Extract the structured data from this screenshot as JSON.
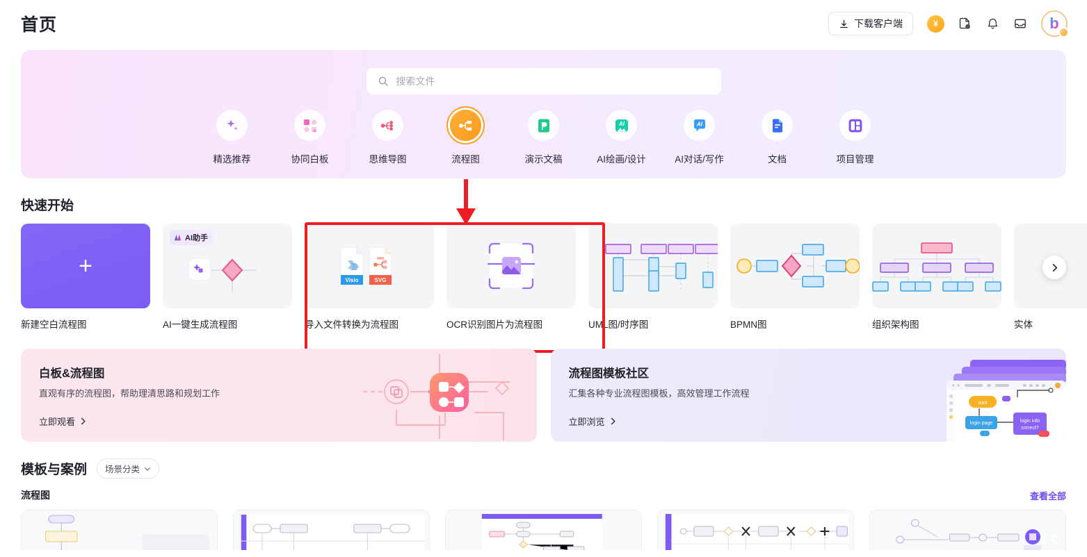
{
  "header": {
    "title": "首页",
    "download_label": "下载客户端",
    "coin_glyph": "¥",
    "avatar_letter": "b",
    "icons": [
      "download-icon",
      "coin-icon",
      "doc-link-icon",
      "bell-icon",
      "inbox-icon",
      "avatar"
    ]
  },
  "hero": {
    "search": {
      "placeholder": "搜索文件",
      "value": ""
    },
    "categories": [
      {
        "label": "精选推荐",
        "icon": "sparkle-icon",
        "active": false
      },
      {
        "label": "协同白板",
        "icon": "whiteboard-icon",
        "active": false
      },
      {
        "label": "思维导图",
        "icon": "mindmap-icon",
        "active": false
      },
      {
        "label": "流程图",
        "icon": "flowchart-icon",
        "active": true
      },
      {
        "label": "演示文稿",
        "icon": "presentation-icon",
        "active": false
      },
      {
        "label": "AI绘画/设计",
        "icon": "ai-image-icon",
        "active": false
      },
      {
        "label": "AI对话/写作",
        "icon": "ai-chat-icon",
        "active": false
      },
      {
        "label": "文档",
        "icon": "document-icon",
        "active": false
      },
      {
        "label": "项目管理",
        "icon": "project-icon",
        "active": false
      }
    ]
  },
  "quickstart": {
    "title": "快速开始",
    "items": [
      {
        "label": "新建空白流程图",
        "thumb": "blank-plus"
      },
      {
        "label": "AI一键生成流程图",
        "thumb": "ai-flow",
        "tag": "AI助手"
      },
      {
        "label": "导入文件转换为流程图",
        "thumb": "import-files"
      },
      {
        "label": "OCR识别图片为流程图",
        "thumb": "ocr-image"
      },
      {
        "label": "UML图/时序图",
        "thumb": "uml-sequence"
      },
      {
        "label": "BPMN图",
        "thumb": "bpmn"
      },
      {
        "label": "组织架构图",
        "thumb": "org-chart"
      },
      {
        "label": "实体",
        "thumb": "entity"
      }
    ],
    "file_badges": [
      "Visio",
      "SVG"
    ],
    "next_icon": "chevron-right-icon",
    "annotation": {
      "arrow_color": "#ee1c25",
      "box_color": "#ee1c25"
    }
  },
  "promos": [
    {
      "title": "白板&流程图",
      "subtitle": "直观有序的流程图，帮助理清思路和规划工作",
      "link": "立即观看",
      "accent": "#fde7ee"
    },
    {
      "title": "流程图模板社区",
      "subtitle": "汇集各种专业流程图模板，高效管理工作流程",
      "link": "立即浏览",
      "accent": "#eeeafb"
    }
  ],
  "templates": {
    "title": "模板与案例",
    "filter_label": "场景分类",
    "category": "流程图",
    "view_all": "查看全部",
    "watermark": "WX.C",
    "cards": [
      {
        "name": "template-card-1"
      },
      {
        "name": "template-card-2"
      },
      {
        "name": "template-card-3"
      },
      {
        "name": "template-card-4"
      },
      {
        "name": "template-card-5"
      }
    ]
  }
}
